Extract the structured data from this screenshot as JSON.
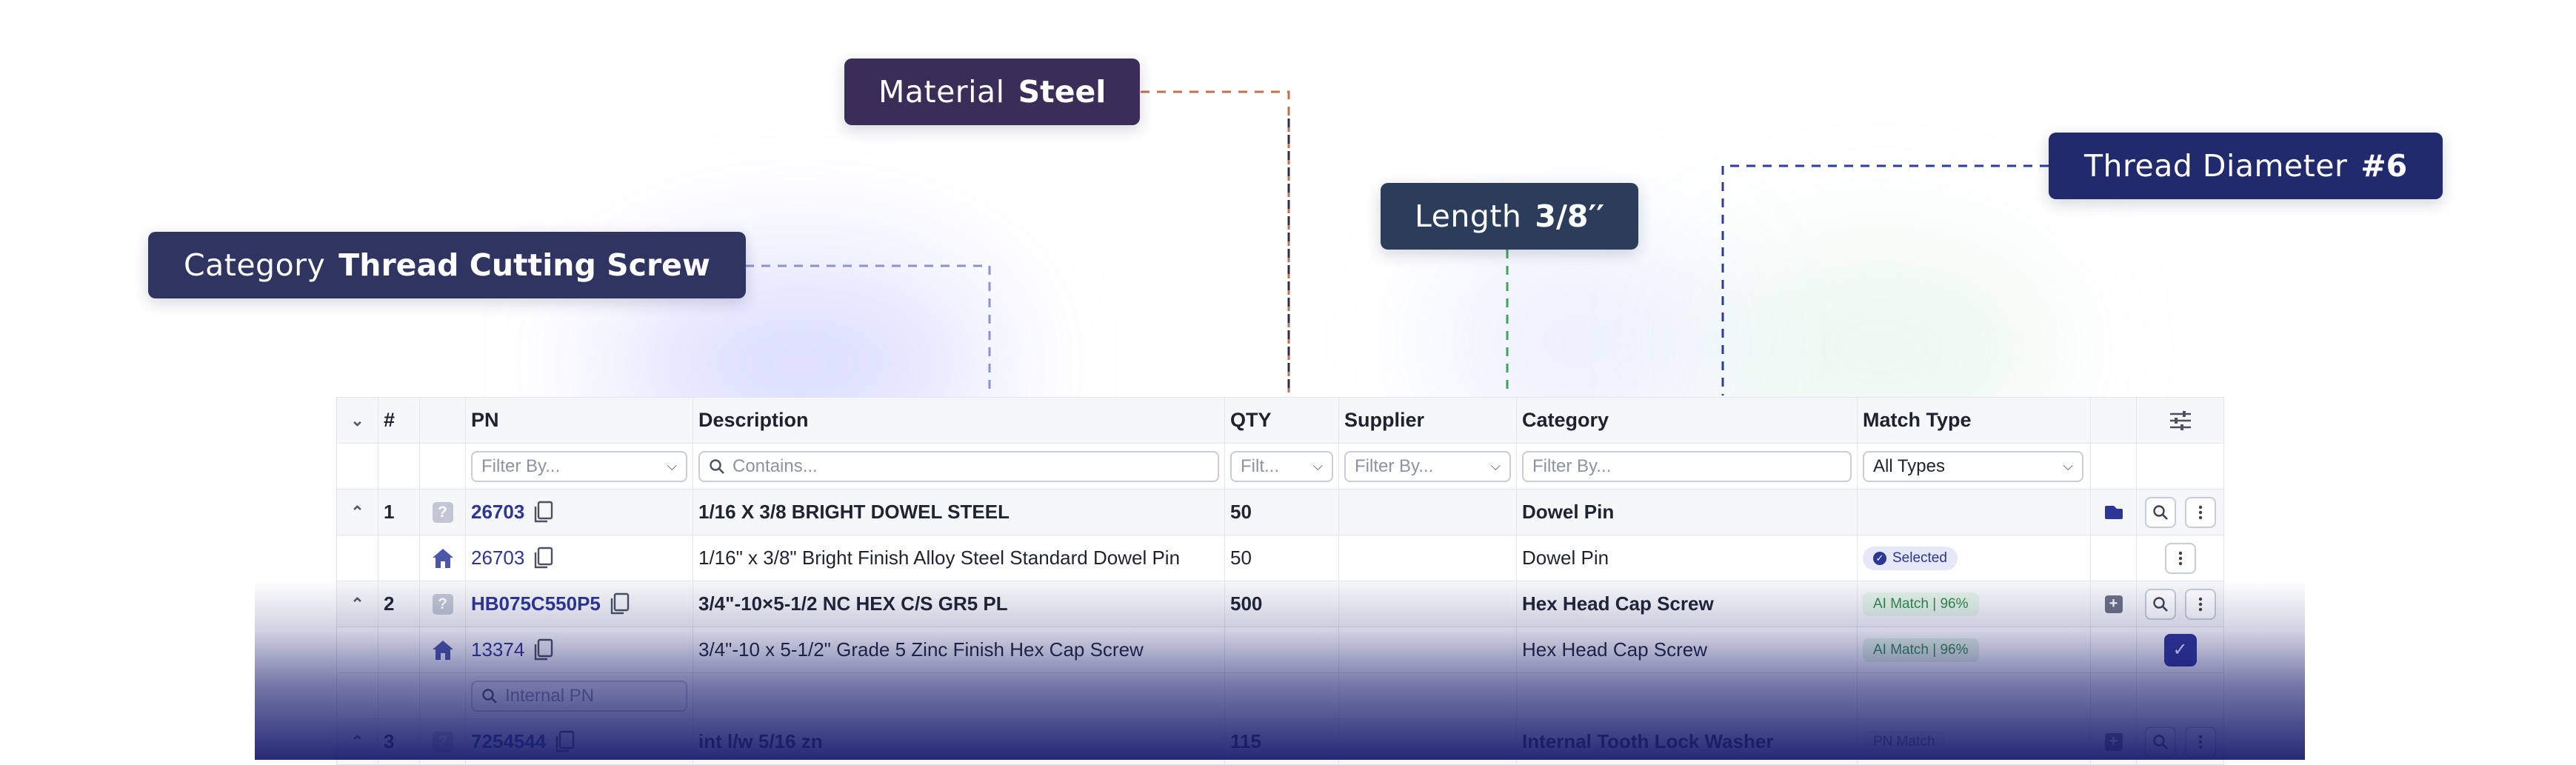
{
  "callouts": {
    "material": {
      "key": "Material",
      "value": "Steel"
    },
    "category": {
      "key": "Category",
      "value": "Thread Cutting Screw"
    },
    "length": {
      "key": "Length",
      "value": "3/8′′"
    },
    "thread": {
      "key": "Thread Diameter",
      "value": "#6"
    }
  },
  "colors": {
    "accent": "#2d3596",
    "material_callout": "#3a2d57",
    "category_callout": "#2f3560",
    "length_callout": "#2c3d5c",
    "thread_callout": "#222a6e",
    "ai_match_bg": "#e3f3e6",
    "ai_match_text": "#2f8a45",
    "selected_bg": "#e4e8f9",
    "fade": "#1a1e6e"
  },
  "table": {
    "headers": {
      "num": "#",
      "pn": "PN",
      "description": "Description",
      "qty": "QTY",
      "supplier": "Supplier",
      "category": "Category",
      "match_type": "Match Type"
    },
    "filters": {
      "pn": "Filter By...",
      "description": "Contains...",
      "qty": "Filt...",
      "supplier": "Filter By...",
      "category": "Filter By...",
      "match_type": "All Types"
    },
    "rows": [
      {
        "num": "1",
        "pn": "26703",
        "description": "1/16 X 3/8 BRIGHT DOWEL STEEL",
        "qty": "50",
        "supplier": "",
        "category": "Dowel Pin",
        "match_type": "",
        "child": {
          "pn": "26703",
          "description": "1/16\" x 3/8\" Bright Finish Alloy Steel Standard Dowel Pin",
          "qty": "50",
          "category": "Dowel Pin",
          "match": "Selected"
        }
      },
      {
        "num": "2",
        "pn": "HB075C550P5",
        "description": "3/4\"-10×5-1/2 NC HEX C/S GR5 PL",
        "qty": "500",
        "supplier": "",
        "category": "Hex Head Cap Screw",
        "match_type": "AI Match | 96%",
        "child": {
          "pn": "13374",
          "description": "3/4\"-10 x 5-1/2\" Grade 5 Zinc Finish Hex Cap Screw",
          "qty": "",
          "category": "Hex Head Cap Screw",
          "match": "AI Match | 96%"
        },
        "internal_pn_placeholder": "Internal PN"
      },
      {
        "num": "3",
        "pn": "7254544",
        "description": "int l/w 5/16 zn",
        "qty": "115",
        "supplier": "",
        "category": "Internal Tooth Lock Washer",
        "match_type": "PN Match"
      }
    ]
  },
  "icons": {
    "collapse_all": "chevron-down-icon",
    "row_toggle": "chevron-up-icon",
    "unknown_part": "question-icon",
    "internal_part": "home-icon",
    "copy": "copy-icon",
    "search": "search-icon",
    "more": "more-vertical-icon",
    "check": "check-icon",
    "columns_settings": "sliders-icon",
    "tag": "tag-icon",
    "add": "plus-square-icon"
  }
}
